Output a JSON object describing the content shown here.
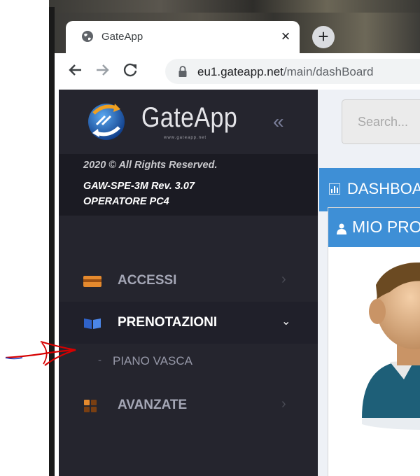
{
  "browser": {
    "tab_title": "GateApp",
    "tab_close": "×",
    "new_tab": "+",
    "url_host": "eu1.gateapp.net",
    "url_path": "/main/dashBoard"
  },
  "app": {
    "logo_text": "GateApp",
    "logo_sub": "www.gateapp.net",
    "collapse": "«",
    "copyright": "2020 © All Rights Reserved.",
    "version": "GAW-SPE-3M Rev. 3.07",
    "operator": "OPERATORE PC4"
  },
  "menu": {
    "items": [
      {
        "label": "ACCESSI",
        "icon": "wallet-icon",
        "expanded": false
      },
      {
        "label": "PRENOTAZIONI",
        "icon": "book-icon",
        "expanded": true
      },
      {
        "label": "AVANZATE",
        "icon": "grid-icon",
        "expanded": false
      }
    ],
    "submenu": {
      "dash": "-",
      "label": "PIANO VASCA"
    }
  },
  "content": {
    "search_placeholder": "Search...",
    "dashboard_title": "DASHBOARD",
    "profile_title": "MIO PROFILO"
  },
  "colors": {
    "sidebar": "#25252e",
    "accent_blue": "#3e8fd6",
    "annotation_red": "#d60000"
  }
}
